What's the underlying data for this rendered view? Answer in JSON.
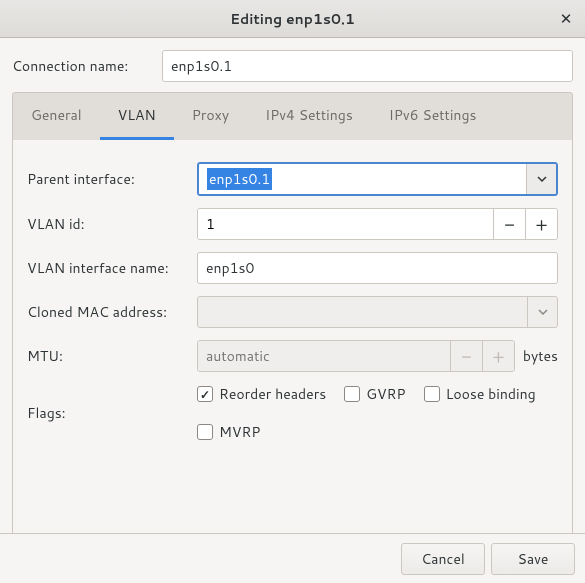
{
  "window": {
    "title": "Editing enp1s0.1"
  },
  "connection": {
    "label": "Connection name:",
    "value": "enp1s0.1"
  },
  "tabs": {
    "general": "General",
    "vlan": "VLAN",
    "proxy": "Proxy",
    "ipv4": "IPv4 Settings",
    "ipv6": "IPv6 Settings"
  },
  "vlan": {
    "parent_label": "Parent interface:",
    "parent_value": "enp1s0.1",
    "id_label": "VLAN id:",
    "id_value": "1",
    "ifname_label": "VLAN interface name:",
    "ifname_value": "enp1s0",
    "mac_label": "Cloned MAC address:",
    "mac_value": "",
    "mtu_label": "MTU:",
    "mtu_placeholder": "automatic",
    "mtu_suffix": "bytes",
    "flags_label": "Flags:",
    "flag_reorder": "Reorder headers",
    "flag_gvrp": "GVRP",
    "flag_loose": "Loose binding",
    "flag_mvrp": "MVRP"
  },
  "buttons": {
    "cancel": "Cancel",
    "save": "Save"
  }
}
